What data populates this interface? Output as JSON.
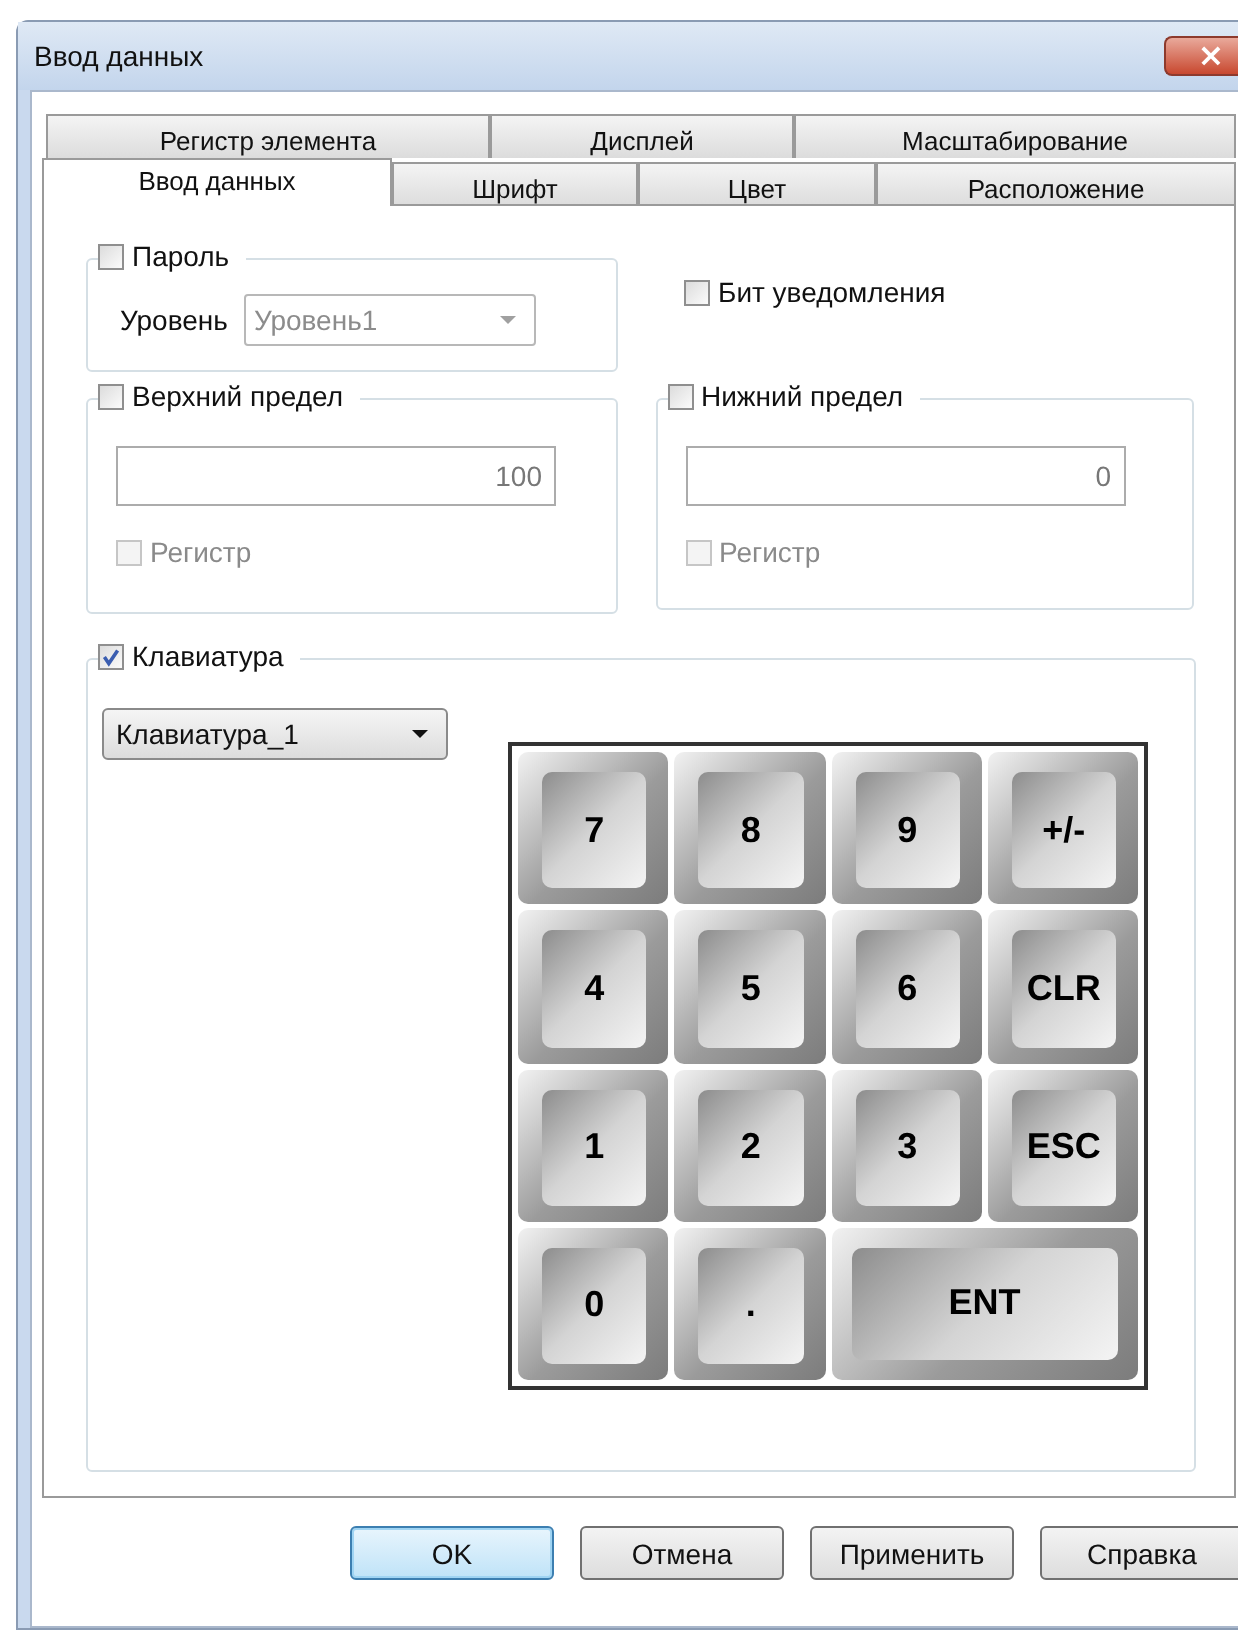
{
  "window": {
    "title": "Ввод данных",
    "close_label": "×"
  },
  "tab_rows": [
    {
      "tabs": [
        {
          "label": "Регистр элемента",
          "selected": false
        },
        {
          "label": "Дисплей",
          "selected": false
        },
        {
          "label": "Масштабирование",
          "selected": false
        }
      ]
    },
    {
      "tabs": [
        {
          "label": "Ввод данных",
          "selected": true
        },
        {
          "label": "Шрифт",
          "selected": false
        },
        {
          "label": "Цвет",
          "selected": false
        },
        {
          "label": "Расположение",
          "selected": false
        }
      ]
    }
  ],
  "password": {
    "label": "Пароль",
    "checked": false,
    "level_label": "Уровень",
    "level_value": "Уровень1",
    "disabled": true
  },
  "notify_bit": {
    "label": "Бит уведомления",
    "checked": false
  },
  "limits": [
    {
      "label": "Верхний предел",
      "checked": false,
      "value": "100",
      "register": {
        "label": "Регистр",
        "checked": false,
        "disabled": true
      }
    },
    {
      "label": "Нижний предел",
      "checked": false,
      "value": "0",
      "register": {
        "label": "Регистр",
        "checked": false,
        "disabled": true
      }
    }
  ],
  "keyboard": {
    "label": "Клавиатура",
    "checked": true,
    "select_value": "Клавиатура_1",
    "keys": [
      {
        "label": "7",
        "kind": "normal"
      },
      {
        "label": "8",
        "kind": "normal"
      },
      {
        "label": "9",
        "kind": "normal"
      },
      {
        "label": "+/-",
        "kind": "normal"
      },
      {
        "label": "4",
        "kind": "normal"
      },
      {
        "label": "5",
        "kind": "normal"
      },
      {
        "label": "6",
        "kind": "normal"
      },
      {
        "label": "CLR",
        "kind": "normal"
      },
      {
        "label": "1",
        "kind": "normal"
      },
      {
        "label": "2",
        "kind": "normal"
      },
      {
        "label": "3",
        "kind": "normal"
      },
      {
        "label": "ESC",
        "kind": "normal"
      },
      {
        "label": "0",
        "kind": "normal"
      },
      {
        "label": ".",
        "kind": "normal"
      },
      {
        "label": "ENT",
        "kind": "wide"
      }
    ]
  },
  "buttons": [
    {
      "label": "OK",
      "default": true
    },
    {
      "label": "Отмена",
      "default": false
    },
    {
      "label": "Применить",
      "default": false
    },
    {
      "label": "Справка",
      "default": false
    }
  ]
}
